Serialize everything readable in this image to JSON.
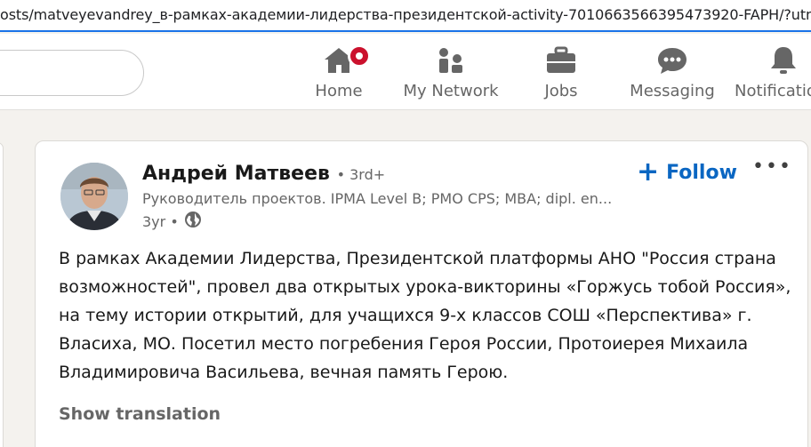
{
  "browser": {
    "url": "osts/matveyevandrey_в-рамках-академии-лидерства-президентской-activity-7010663566395473920-FAPH/?utm_sou"
  },
  "nav": {
    "items": [
      {
        "label": "Home",
        "icon": "home-icon"
      },
      {
        "label": "My Network",
        "icon": "network-icon"
      },
      {
        "label": "Jobs",
        "icon": "briefcase-icon"
      },
      {
        "label": "Messaging",
        "icon": "messaging-icon"
      },
      {
        "label": "Notifications",
        "icon": "bell-icon"
      }
    ]
  },
  "post": {
    "author": {
      "name": "Андрей Матвеев",
      "degree": "• 3rd+",
      "headline": "Руководитель проектов. IPMA Level B; PMO CPS; MBA; dipl. en...",
      "age": "3yr •"
    },
    "follow_label": "Follow",
    "more_label": "•••",
    "text": "В рамках Академии Лидерства, Президентской платформы АНО \"Россия страна возможностей\", провел два открытых урока-викторины «Горжусь тобой Россия», на тему истории открытий, для учащихся 9-х классов СОШ «Перспектива» г. Власиха, МО. Посетил место погребения Героя России, Протоиерея Михаила Владимировича Васильева, вечная память Герою.",
    "show_translation": "Show translation"
  },
  "colors": {
    "accent": "#0a66c2",
    "badge": "#cb112d",
    "background": "#f4f2ee"
  }
}
